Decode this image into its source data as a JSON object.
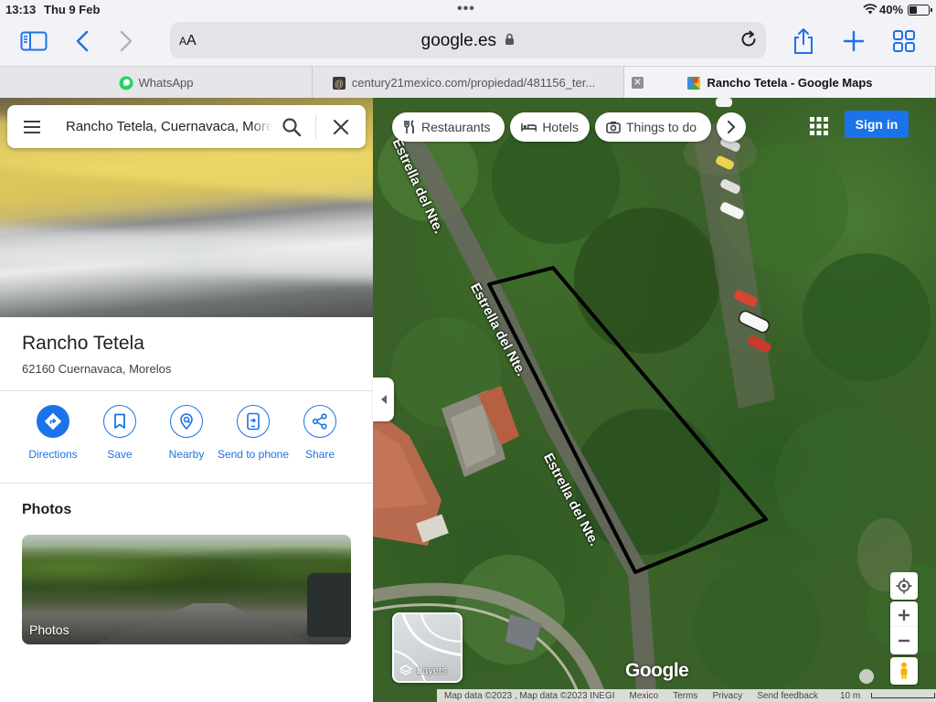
{
  "status_bar": {
    "time": "13:13",
    "date": "Thu 9 Feb",
    "battery_percent": "40%",
    "battery_level": 0.4
  },
  "safari": {
    "text_size_label": "AA",
    "url": "google.es",
    "tabs": [
      {
        "title": "WhatsApp",
        "favicon": "whatsapp-icon",
        "active": false
      },
      {
        "title": "century21mexico.com/propiedad/481156_ter...",
        "favicon": "century21-icon",
        "active": false
      },
      {
        "title": "Rancho Tetela - Google Maps",
        "favicon": "google-maps-icon",
        "active": true
      }
    ]
  },
  "search": {
    "query": "Rancho Tetela, Cuernavaca, Morelos"
  },
  "place": {
    "name": "Rancho Tetela",
    "address": "62160 Cuernavaca, Morelos"
  },
  "actions": [
    {
      "label": "Directions",
      "icon": "directions-icon"
    },
    {
      "label": "Save",
      "icon": "bookmark-icon"
    },
    {
      "label": "Nearby",
      "icon": "nearby-icon"
    },
    {
      "label": "Send to phone",
      "icon": "send-to-phone-icon"
    },
    {
      "label": "Share",
      "icon": "share-icon"
    }
  ],
  "photos": {
    "title": "Photos",
    "card_caption": "Photos"
  },
  "map": {
    "chips": [
      {
        "label": "Restaurants",
        "icon": "restaurant-icon"
      },
      {
        "label": "Hotels",
        "icon": "hotel-icon"
      },
      {
        "label": "Things to do",
        "icon": "camera-icon"
      }
    ],
    "sign_in": "Sign in",
    "road_labels": [
      "Estrella del Nte.",
      "Estrella del Nte.",
      "Estrella del Nte."
    ],
    "layers_label": "Layers",
    "logo": "Google",
    "attribution": [
      "Map data ©2023 , Map data ©2023 INEGI",
      "Mexico",
      "Terms",
      "Privacy",
      "Send feedback"
    ],
    "scale": "10 m"
  },
  "colors": {
    "accent": "#1a73e8",
    "sign_in_bg": "#1a73e8"
  }
}
